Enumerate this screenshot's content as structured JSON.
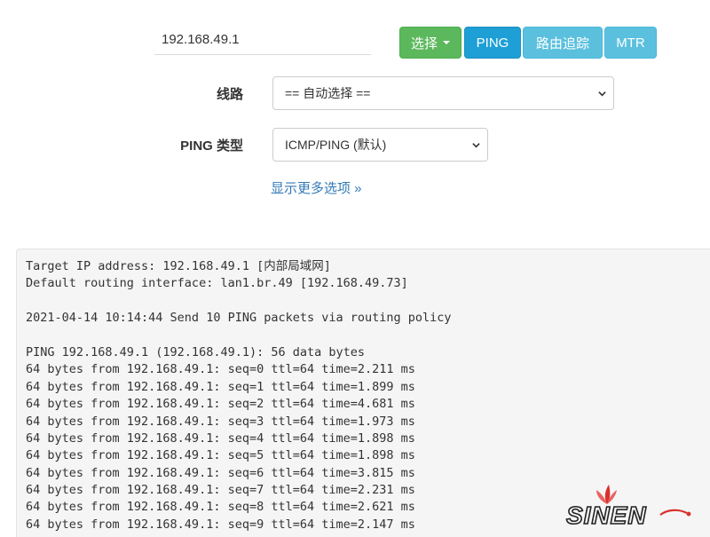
{
  "form": {
    "ip_value": "192.168.49.1",
    "buttons": {
      "select": "选择",
      "ping": "PING",
      "traceroute": "路由追踪",
      "mtr": "MTR"
    },
    "route_label": "线路",
    "route_selected": "== 自动选择 ==",
    "ping_type_label": "PING 类型",
    "ping_type_selected": "ICMP/PING (默认)",
    "more_options": "显示更多选项 »"
  },
  "output": {
    "target_line": "Target IP address: 192.168.49.1 [内部局域网]",
    "interface_line": "Default routing interface: lan1.br.49 [192.168.49.73]",
    "send_line": "2021-04-14 10:14:44 Send 10 PING packets via routing policy",
    "ping_header": "PING 192.168.49.1 (192.168.49.1): 56 data bytes",
    "replies": [
      "64 bytes from 192.168.49.1: seq=0 ttl=64 time=2.211 ms",
      "64 bytes from 192.168.49.1: seq=1 ttl=64 time=1.899 ms",
      "64 bytes from 192.168.49.1: seq=2 ttl=64 time=4.681 ms",
      "64 bytes from 192.168.49.1: seq=3 ttl=64 time=1.973 ms",
      "64 bytes from 192.168.49.1: seq=4 ttl=64 time=1.898 ms",
      "64 bytes from 192.168.49.1: seq=5 ttl=64 time=1.898 ms",
      "64 bytes from 192.168.49.1: seq=6 ttl=64 time=3.815 ms",
      "64 bytes from 192.168.49.1: seq=7 ttl=64 time=2.231 ms",
      "64 bytes from 192.168.49.1: seq=8 ttl=64 time=2.621 ms",
      "64 bytes from 192.168.49.1: seq=9 ttl=64 time=2.147 ms"
    ]
  },
  "watermark": {
    "text": "SINEN"
  },
  "colors": {
    "select_button": "#5cb85c",
    "ping_button": "#1e9fd6",
    "info_button": "#5bc0de",
    "link": "#337ab7",
    "output_background": "#f5f5f5",
    "logo_red": "#d9302c"
  }
}
